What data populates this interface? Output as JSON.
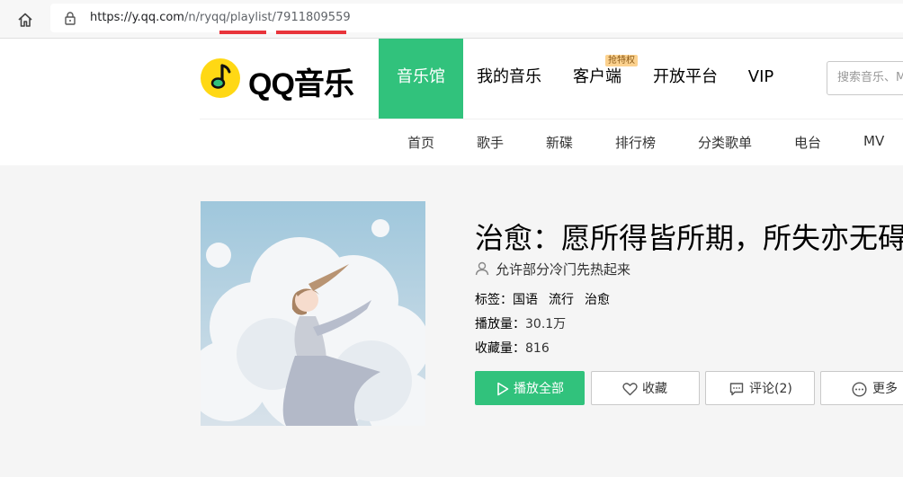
{
  "browser": {
    "url_host": "https://y.qq.com",
    "url_path": "/n/ryqq/playlist/7911809559"
  },
  "header": {
    "logo_text": "QQ音乐",
    "nav": [
      {
        "label": "音乐馆",
        "active": true
      },
      {
        "label": "我的音乐",
        "active": false
      },
      {
        "label": "客户端",
        "active": false,
        "badge": "抢特权"
      },
      {
        "label": "开放平台",
        "active": false
      },
      {
        "label": "VIP",
        "active": false
      }
    ],
    "search_placeholder": "搜索音乐、MV、歌单、用户",
    "subnav": [
      "首页",
      "歌手",
      "新碟",
      "排行榜",
      "分类歌单",
      "电台",
      "MV"
    ]
  },
  "playlist": {
    "title": "治愈：愿所得皆所期，所失亦无碍",
    "creator": "允许部分冷门先热起来",
    "tags_label": "标签：",
    "tags": [
      "国语",
      "流行",
      "治愈"
    ],
    "plays_label": "播放量：",
    "plays": "30.1万",
    "favorites_label": "收藏量：",
    "favorites": "816"
  },
  "actions": {
    "play_all": "播放全部",
    "collect": "收藏",
    "comment": "评论(2)",
    "more": "更多"
  },
  "colors": {
    "brand_green": "#31c27c",
    "highlight_red": "#e8343b"
  }
}
